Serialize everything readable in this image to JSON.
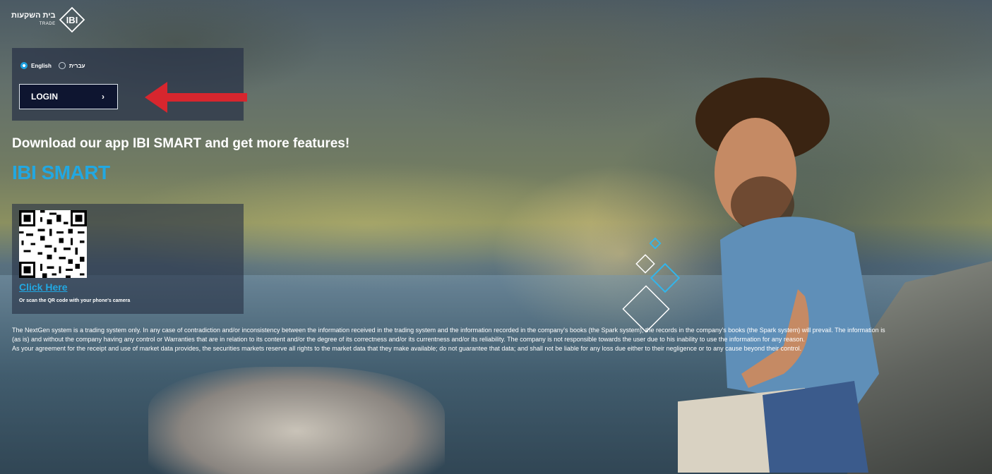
{
  "logo": {
    "hebrew_name": "בית השקעות",
    "sub_label": "TRADE",
    "mark": "IBI"
  },
  "language": {
    "options": [
      {
        "label": "English",
        "selected": true
      },
      {
        "label": "עברית",
        "selected": false
      }
    ]
  },
  "login": {
    "label": "LOGIN",
    "chevron": "›"
  },
  "promo": {
    "headline": "Download our app IBI SMART and get more features!",
    "brand": "IBI SMART"
  },
  "qr": {
    "link_text": "Click Here",
    "note": "Or scan the QR code with your phone's camera"
  },
  "disclaimer": {
    "line1": "The NextGen system is a trading system only. In any case of contradiction and/or inconsistency between the information received in the trading system and the information recorded in the company's books (the Spark system), the records in the company's books (the Spark system) will prevail. The information is",
    "line2": "(as is) and without the company having any control or Warranties that are in relation to its content and/or the degree of its correctness and/or its currentness and/or its reliability. The company is not responsible towards the user due to his inability to use the information for any reason.",
    "line3": "As your agreement for the receipt and use of market data provides, the securities markets reserve all rights to the market data that they make available; do not guarantee that data; and shall not be liable for any loss due either to their negligence or to any cause beyond their control."
  },
  "colors": {
    "accent": "#22a8e2",
    "button_bg": "#0e1530",
    "arrow": "#d7262e"
  }
}
